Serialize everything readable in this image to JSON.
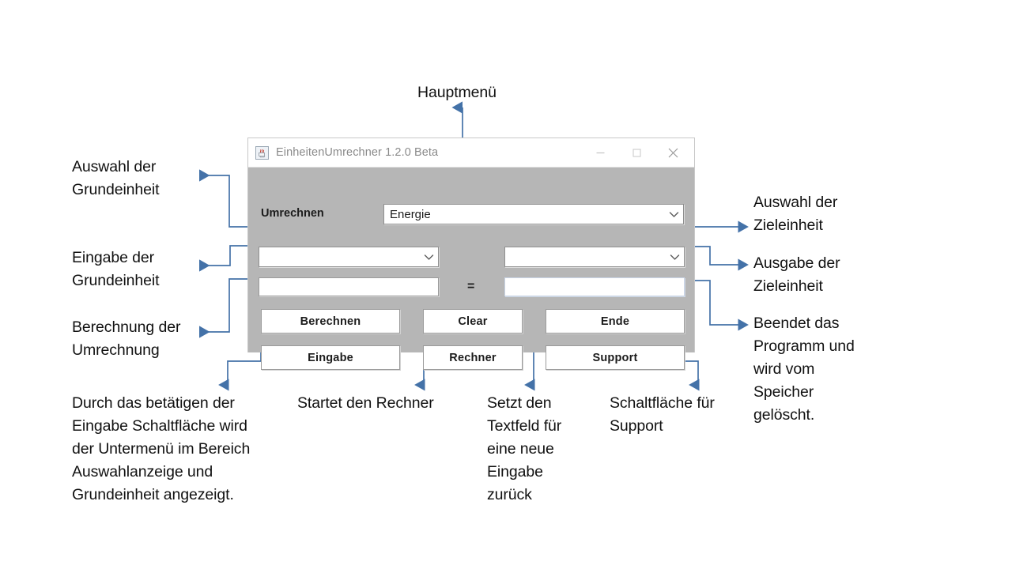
{
  "window": {
    "title": "EinheitenUmrechner 1.2.0 Beta",
    "icon": "java-coffee-cup-icon",
    "controls": {
      "minimize": "minimize-icon",
      "maximize": "maximize-icon",
      "close": "close-icon"
    },
    "label_umrechnen": "Umrechnen",
    "main_combo": {
      "value": "Energie",
      "placeholder": ""
    },
    "source_combo": {
      "value": "",
      "placeholder": ""
    },
    "target_combo": {
      "value": "",
      "placeholder": ""
    },
    "source_field": {
      "value": "",
      "placeholder": ""
    },
    "result_field": {
      "value": "",
      "placeholder": ""
    },
    "equals": "=",
    "buttons": {
      "berechnen": "Berechnen",
      "clear": "Clear",
      "ende": "Ende",
      "eingabe": "Eingabe",
      "rechner": "Rechner",
      "support": "Support"
    }
  },
  "annotations": {
    "hauptmenu": "Hauptmenü",
    "auswahl_grundeinheit": "Auswahl der\nGrundeinheit",
    "eingabe_grundeinheit": "Eingabe der\nGrundeinheit",
    "berechnung_umrechnung": "Berechnung der\nUmrechnung",
    "auswahl_zieleinheit": "Auswahl der\nZieleinheit",
    "ausgabe_zieleinheit": "Ausgabe der\nZieleinheit",
    "beendet_programm": "Beendet das\nProgramm und\nwird vom\nSpeicher\ngelöscht.",
    "durch_betaetigen": "Durch das betätigen der\nEingabe Schaltfläche wird\nder Untermenü im Bereich\nAuswahlanzeige und\nGrundeinheit angezeigt.",
    "startet_rechner": "Startet den Rechner",
    "setzt_textfeld": "Setzt den\nTextfeld für\neine neue\nEingabe\nzurück",
    "schaltflaeche_support": "Schaltfläche für\nSupport"
  },
  "colors": {
    "connector": "#4472a8",
    "panel": "#b6b6b6",
    "titlebar": "#ffffff",
    "field": "#ffffff",
    "text": "#111111"
  }
}
